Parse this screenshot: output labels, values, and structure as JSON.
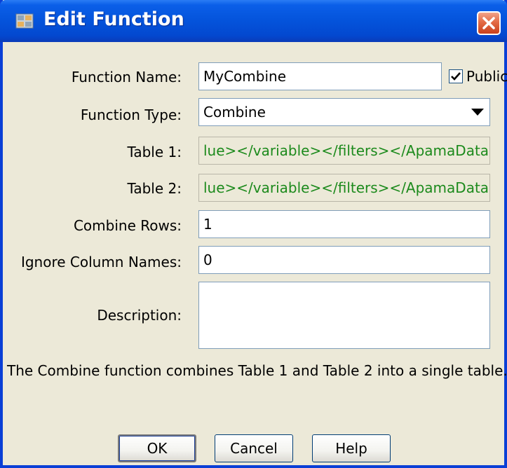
{
  "window": {
    "title": "Edit Function",
    "icon": "function-icon",
    "close_icon": "close-icon"
  },
  "form": {
    "function_name": {
      "label": "Function Name:",
      "value": "MyCombine"
    },
    "public": {
      "label": "Public",
      "checked": true
    },
    "function_type": {
      "label": "Function Type:",
      "value": "Combine"
    },
    "table1": {
      "label": "Table 1:",
      "value": "lue></variable></filters></ApamaData>"
    },
    "table2": {
      "label": "Table 2:",
      "value": "lue></variable></filters></ApamaData>"
    },
    "combine_rows": {
      "label": "Combine Rows:",
      "value": "1"
    },
    "ignore_column_names": {
      "label": "Ignore Column Names:",
      "value": "0"
    },
    "description": {
      "label": "Description:",
      "value": ""
    }
  },
  "info_text": "The Combine function combines Table 1 and Table 2 into a single table.",
  "buttons": {
    "ok": "OK",
    "cancel": "Cancel",
    "help": "Help"
  },
  "colors": {
    "titlebar": "#0453db",
    "readonly_text": "#1c8a1c",
    "close_button": "#e36b45"
  }
}
